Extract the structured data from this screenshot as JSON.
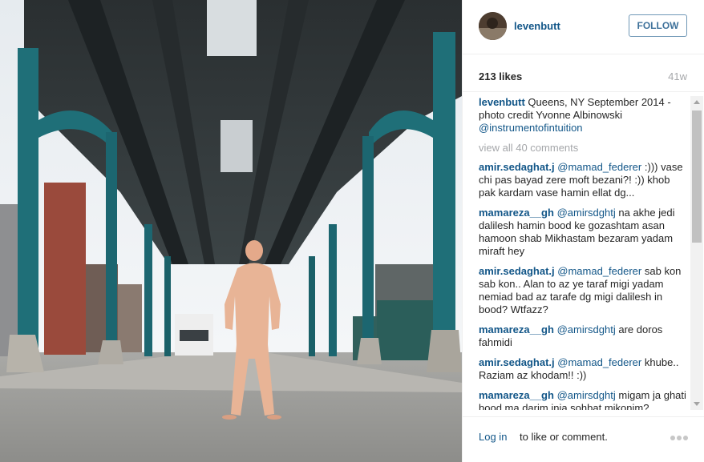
{
  "post": {
    "username": "levenbutt",
    "follow_label": "FOLLOW",
    "likes": "213 likes",
    "age": "41w",
    "caption": {
      "author": "levenbutt",
      "text": "Queens, NY September 2014 - photo credit Yvonne Albinowski",
      "mention": "@instrumentofintuition"
    },
    "view_all": "view all 40 comments",
    "comments": [
      {
        "author": "amir.sedaghat.j",
        "mention": "@mamad_federer",
        "text": ":))) vase chi pas bayad zere moft bezani?! :)) khob pak kardam vase hamin ellat dg..."
      },
      {
        "author": "mamareza__gh",
        "mention": "@amirsdghtj",
        "text": "na akhe jedi dalilesh hamin bood ke gozashtam asan hamoon shab Mikhastam bezaram yadam miraft hey"
      },
      {
        "author": "amir.sedaghat.j",
        "mention": "@mamad_federer",
        "text": "sab kon sab kon.. Alan to az ye taraf migi yadam nemiad bad az tarafe dg migi dalilesh in bood? Wtfazz?"
      },
      {
        "author": "mamareza__gh",
        "mention": "@amirsdghtj",
        "text": "are doros fahmidi ‌‌‌"
      },
      {
        "author": "amir.sedaghat.j",
        "mention": "@mamad_federer",
        "text": "khube.. Raziam az khodam!! :))"
      },
      {
        "author": "mamareza__gh",
        "mention": "@amirsdghtj",
        "text": "migam ja ghati bood ma darim inja sohbat mikonim? ‌‌"
      }
    ],
    "footer": {
      "login_label": "Log in",
      "footer_text": "to like or comment."
    }
  },
  "colors": {
    "link": "#125688",
    "muted": "#a5a7aa",
    "follow_border": "#6f97b6",
    "follow_text": "#3f729b",
    "steel_green": "#1f6f78"
  },
  "icons": {
    "more": "more-dots-icon",
    "scroll_up": "scroll-up-arrow-icon",
    "scroll_down": "scroll-down-arrow-icon"
  }
}
